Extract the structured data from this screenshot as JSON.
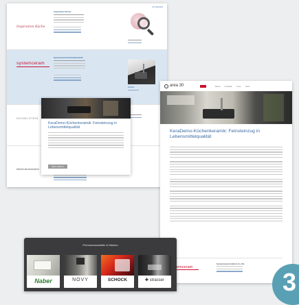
{
  "page1": {
    "top_link": "Zur Übersicht",
    "entries": [
      {
        "logo_text": "Inspiration Küche",
        "company": "Inspiration Küche",
        "has_magnifier": true
      },
      {
        "logo_text": "systemceram",
        "company": "Systemceram Küchenkeramik",
        "tag": "Website"
      },
      {
        "logo_text": "KESSELSTEIN",
        "company": "",
        "tag": "Website"
      },
      {
        "logo_text": "kitchenAutomation",
        "company": "",
        "tag": "Website"
      }
    ],
    "popup": {
      "title": "KeraDemo-Küchenkeramik: Feinsteinzug in Lebensmittelqualität",
      "button": "Mehr erfahren"
    }
  },
  "page2": {
    "logo": "area 30",
    "nav": [
      "Messe",
      "Aussteller",
      "Foren",
      "News"
    ],
    "heading": "KeraDemo-Küchenkeramik: Feinsteinzug in Lebensmittelqualität",
    "footer_logo": "systemceram",
    "footer_company": "Systemceram GmbH & Co. KG"
  },
  "page3": {
    "title": "Premiumaussteller & Marken",
    "brands": [
      "Naber",
      "NOVY",
      "SCHOCK",
      "strasser"
    ]
  },
  "badge": "3",
  "colors": {
    "link_blue": "#3a6aa0",
    "systemceram_red": "#c8102e",
    "naber_green": "#2e7d32",
    "badge_teal": "#5aa0b5",
    "dark_panel": "#3b3b3d"
  }
}
